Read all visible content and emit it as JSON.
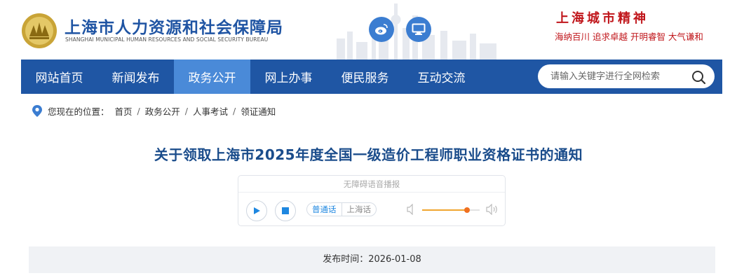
{
  "header": {
    "title": "上海市人力资源和社会保障局",
    "subtitle": "SHANGHAI MUNICIPAL HUMAN RESOURCES AND SOCIAL SECURITY BUREAU",
    "icons": [
      "weibo-icon",
      "monitor-icon"
    ]
  },
  "spirit": {
    "title": "上海城市精神",
    "slogan": "海纳百川 追求卓越 开明睿智 大气谦和"
  },
  "nav": {
    "items": [
      {
        "label": "网站首页"
      },
      {
        "label": "新闻发布"
      },
      {
        "label": "政务公开"
      },
      {
        "label": "网上办事"
      },
      {
        "label": "便民服务"
      },
      {
        "label": "互动交流"
      }
    ],
    "active_index": 2
  },
  "search": {
    "placeholder": "请输入关键字进行全网检索"
  },
  "breadcrumb": {
    "prefix": "您现在的位置：",
    "items": [
      "首页",
      "政务公开",
      "人事考试",
      "领证通知"
    ],
    "separator": "/"
  },
  "article": {
    "title": "关于领取上海市2025年度全国一级造价工程师职业资格证书的通知"
  },
  "player": {
    "header": "无障碍语音播报",
    "lang_mandarin": "普通话",
    "lang_shanghai": "上海话",
    "selected_lang": "普通话",
    "volume": 0.78
  },
  "publish": {
    "label": "发布时间：",
    "date": "2026-01-08"
  },
  "colors": {
    "nav_bg": "#1f56a4",
    "nav_active": "#4a8ad8",
    "title_blue": "#1a4c8b",
    "spirit_red": "#c0161b",
    "volume_orange": "#f07020"
  }
}
